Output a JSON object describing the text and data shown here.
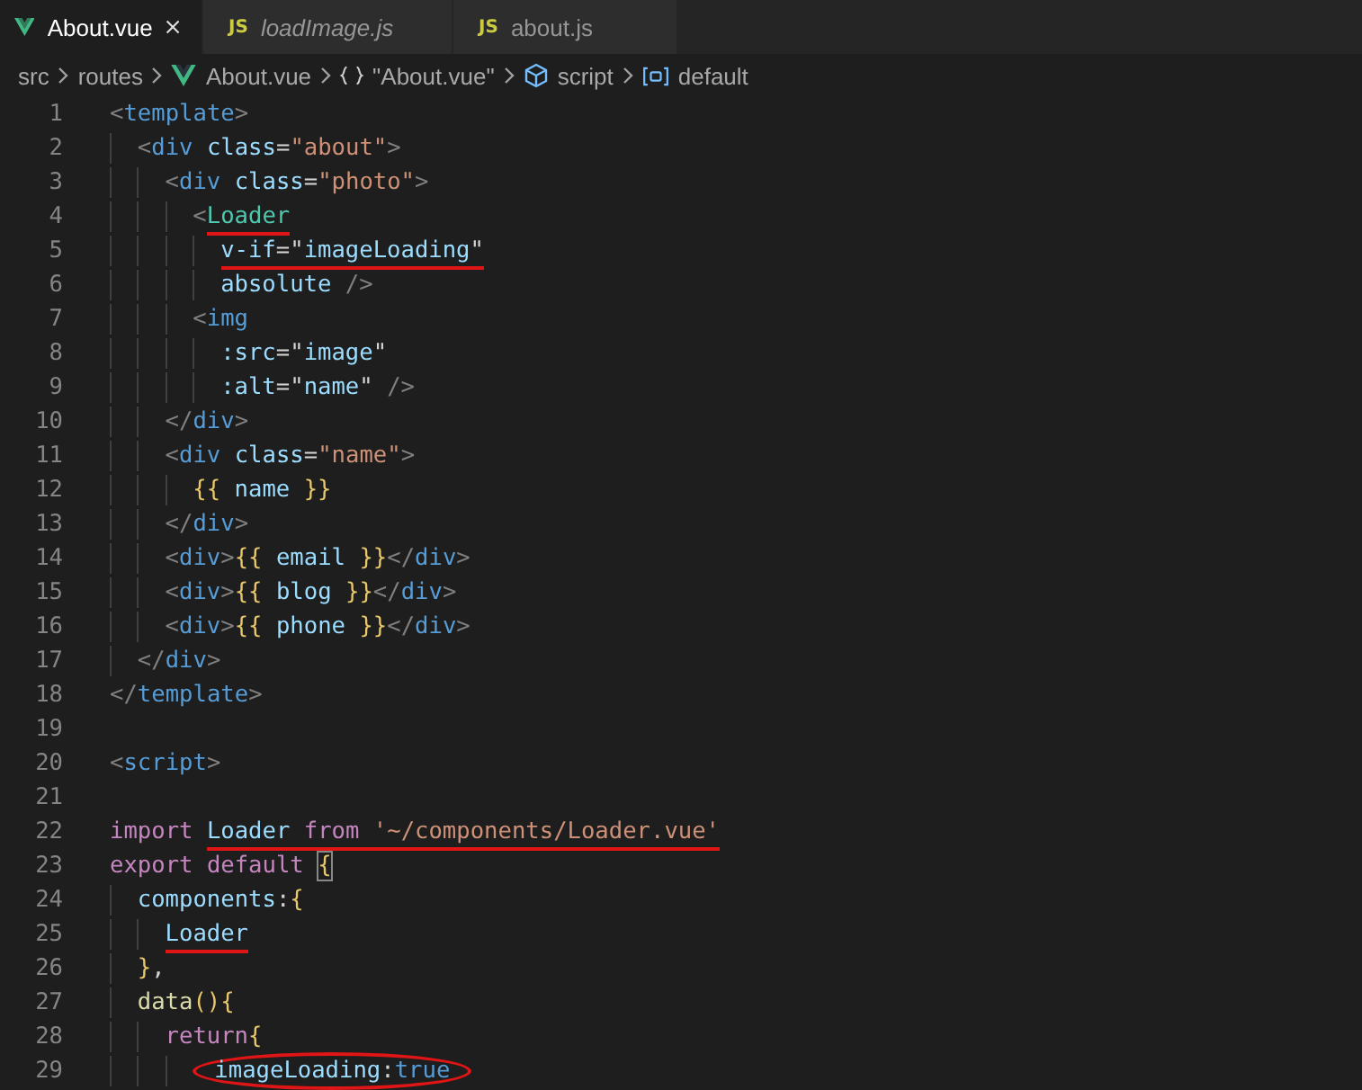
{
  "tabs": [
    {
      "label": "About.vue",
      "kind": "vue",
      "selected": true,
      "preview": false
    },
    {
      "label": "loadImage.js",
      "kind": "js",
      "badge": "JS",
      "selected": false,
      "preview": true
    },
    {
      "label": "about.js",
      "kind": "js",
      "badge": "JS",
      "selected": false,
      "preview": false
    }
  ],
  "breadcrumb": [
    {
      "label": "src"
    },
    {
      "label": "routes"
    },
    {
      "label": "About.vue",
      "kind": "vue"
    },
    {
      "label": "\"About.vue\"",
      "kind": "module"
    },
    {
      "label": "script",
      "kind": "cube"
    },
    {
      "label": "default",
      "kind": "variable"
    }
  ],
  "lines": [
    {
      "number": "1",
      "tokens": [
        {
          "kind": "punct",
          "text": "<"
        },
        {
          "kind": "tag",
          "text": "template"
        },
        {
          "kind": "punct",
          "text": ">"
        }
      ]
    },
    {
      "number": "2",
      "tokens": [
        {
          "kind": "punct",
          "text": "  <"
        },
        {
          "kind": "tag",
          "text": "div "
        },
        {
          "kind": "attr",
          "text": "class"
        },
        {
          "kind": "text",
          "text": "="
        },
        {
          "kind": "string",
          "text": "\"about\""
        },
        {
          "kind": "punct",
          "text": ">"
        }
      ]
    },
    {
      "number": "3",
      "tokens": [
        {
          "kind": "punct",
          "text": "    <"
        },
        {
          "kind": "tag",
          "text": "div "
        },
        {
          "kind": "attr",
          "text": "class"
        },
        {
          "kind": "text",
          "text": "="
        },
        {
          "kind": "string",
          "text": "\"photo\""
        },
        {
          "kind": "punct",
          "text": ">"
        }
      ]
    },
    {
      "number": "4",
      "tokens": [
        {
          "kind": "punct",
          "text": "      <"
        }
      ],
      "underlined_tokens": [
        {
          "kind": "component",
          "text": "Loader"
        }
      ]
    },
    {
      "number": "5",
      "underlined_tokens": [
        {
          "kind": "attr",
          "text": "        v-if"
        },
        {
          "kind": "text",
          "text": "=\""
        },
        {
          "kind": "attr",
          "text": "imageLoading"
        },
        {
          "kind": "text",
          "text": "\""
        }
      ]
    },
    {
      "number": "6",
      "tokens": [
        {
          "kind": "attr",
          "text": "        absolute "
        },
        {
          "kind": "punct",
          "text": "/>"
        }
      ]
    },
    {
      "number": "7",
      "tokens": [
        {
          "kind": "punct",
          "text": "      <"
        },
        {
          "kind": "tag",
          "text": "img"
        }
      ]
    },
    {
      "number": "8",
      "tokens": [
        {
          "kind": "attr",
          "text": "        :src"
        },
        {
          "kind": "text",
          "text": "=\""
        },
        {
          "kind": "attr",
          "text": "image"
        },
        {
          "kind": "text",
          "text": "\""
        }
      ]
    },
    {
      "number": "9",
      "tokens": [
        {
          "kind": "attr",
          "text": "        :alt"
        },
        {
          "kind": "text",
          "text": "=\""
        },
        {
          "kind": "attr",
          "text": "name"
        },
        {
          "kind": "text",
          "text": "\" "
        },
        {
          "kind": "punct",
          "text": "/>"
        }
      ]
    },
    {
      "number": "10",
      "tokens": [
        {
          "kind": "punct",
          "text": "    </"
        },
        {
          "kind": "tag",
          "text": "div"
        },
        {
          "kind": "punct",
          "text": ">"
        }
      ]
    },
    {
      "number": "11",
      "tokens": [
        {
          "kind": "punct",
          "text": "    <"
        },
        {
          "kind": "tag",
          "text": "div "
        },
        {
          "kind": "attr",
          "text": "class"
        },
        {
          "kind": "text",
          "text": "="
        },
        {
          "kind": "string",
          "text": "\"name\""
        },
        {
          "kind": "punct",
          "text": ">"
        }
      ]
    },
    {
      "number": "12",
      "tokens": [
        {
          "kind": "brace",
          "text": "      {{ "
        },
        {
          "kind": "attr",
          "text": "name "
        },
        {
          "kind": "brace",
          "text": "}}"
        }
      ]
    },
    {
      "number": "13",
      "tokens": [
        {
          "kind": "punct",
          "text": "    </"
        },
        {
          "kind": "tag",
          "text": "div"
        },
        {
          "kind": "punct",
          "text": ">"
        }
      ]
    },
    {
      "number": "14",
      "tokens": [
        {
          "kind": "punct",
          "text": "    <"
        },
        {
          "kind": "tag",
          "text": "div"
        },
        {
          "kind": "punct",
          "text": ">"
        },
        {
          "kind": "brace",
          "text": "{{ "
        },
        {
          "kind": "attr",
          "text": "email "
        },
        {
          "kind": "brace",
          "text": "}}"
        },
        {
          "kind": "punct",
          "text": "</"
        },
        {
          "kind": "tag",
          "text": "div"
        },
        {
          "kind": "punct",
          "text": ">"
        }
      ]
    },
    {
      "number": "15",
      "tokens": [
        {
          "kind": "punct",
          "text": "    <"
        },
        {
          "kind": "tag",
          "text": "div"
        },
        {
          "kind": "punct",
          "text": ">"
        },
        {
          "kind": "brace",
          "text": "{{ "
        },
        {
          "kind": "attr",
          "text": "blog "
        },
        {
          "kind": "brace",
          "text": "}}"
        },
        {
          "kind": "punct",
          "text": "</"
        },
        {
          "kind": "tag",
          "text": "div"
        },
        {
          "kind": "punct",
          "text": ">"
        }
      ]
    },
    {
      "number": "16",
      "tokens": [
        {
          "kind": "punct",
          "text": "    <"
        },
        {
          "kind": "tag",
          "text": "div"
        },
        {
          "kind": "punct",
          "text": ">"
        },
        {
          "kind": "brace",
          "text": "{{ "
        },
        {
          "kind": "attr",
          "text": "phone "
        },
        {
          "kind": "brace",
          "text": "}}"
        },
        {
          "kind": "punct",
          "text": "</"
        },
        {
          "kind": "tag",
          "text": "div"
        },
        {
          "kind": "punct",
          "text": ">"
        }
      ]
    },
    {
      "number": "17",
      "tokens": [
        {
          "kind": "punct",
          "text": "  </"
        },
        {
          "kind": "tag",
          "text": "div"
        },
        {
          "kind": "punct",
          "text": ">"
        }
      ]
    },
    {
      "number": "18",
      "tokens": [
        {
          "kind": "punct",
          "text": "</"
        },
        {
          "kind": "tag",
          "text": "template"
        },
        {
          "kind": "punct",
          "text": ">"
        }
      ]
    },
    {
      "number": "19"
    },
    {
      "number": "20",
      "tokens": [
        {
          "kind": "punct",
          "text": "<"
        },
        {
          "kind": "tag",
          "text": "script"
        },
        {
          "kind": "punct",
          "text": ">"
        }
      ]
    },
    {
      "number": "21"
    },
    {
      "number": "22",
      "tokens": [
        {
          "kind": "keyword",
          "text": "import "
        }
      ],
      "underlined_tokens": [
        {
          "kind": "attr",
          "text": "Loader "
        },
        {
          "kind": "keyword",
          "text": "from "
        },
        {
          "kind": "string",
          "text": "'~/components/Loader.vue'"
        }
      ]
    },
    {
      "number": "23",
      "tokens": [
        {
          "kind": "keyword",
          "text": "export "
        },
        {
          "kind": "keyword",
          "text": "default "
        },
        {
          "kind": "matched-brace",
          "text": "{"
        }
      ]
    },
    {
      "number": "24",
      "tokens": [
        {
          "kind": "attr",
          "text": "  components"
        },
        {
          "kind": "text",
          "text": ":"
        },
        {
          "kind": "brace",
          "text": "{"
        }
      ]
    },
    {
      "number": "25",
      "underlined_tokens": [
        {
          "kind": "attr",
          "text": "    Loader"
        }
      ]
    },
    {
      "number": "26",
      "tokens": [
        {
          "kind": "brace",
          "text": "  }"
        },
        {
          "kind": "text",
          "text": ","
        }
      ]
    },
    {
      "number": "27",
      "tokens": [
        {
          "kind": "function",
          "text": "  data"
        },
        {
          "kind": "brace",
          "text": "()"
        },
        {
          "kind": "brace",
          "text": "{"
        }
      ]
    },
    {
      "number": "28",
      "tokens": [
        {
          "kind": "keyword",
          "text": "    return"
        },
        {
          "kind": "brace",
          "text": "{"
        }
      ]
    },
    {
      "number": "29",
      "circled_tokens": [
        {
          "kind": "attr",
          "text": "      imageLoading"
        },
        {
          "kind": "text",
          "text": ":"
        },
        {
          "kind": "constant",
          "text": "true"
        }
      ]
    }
  ]
}
